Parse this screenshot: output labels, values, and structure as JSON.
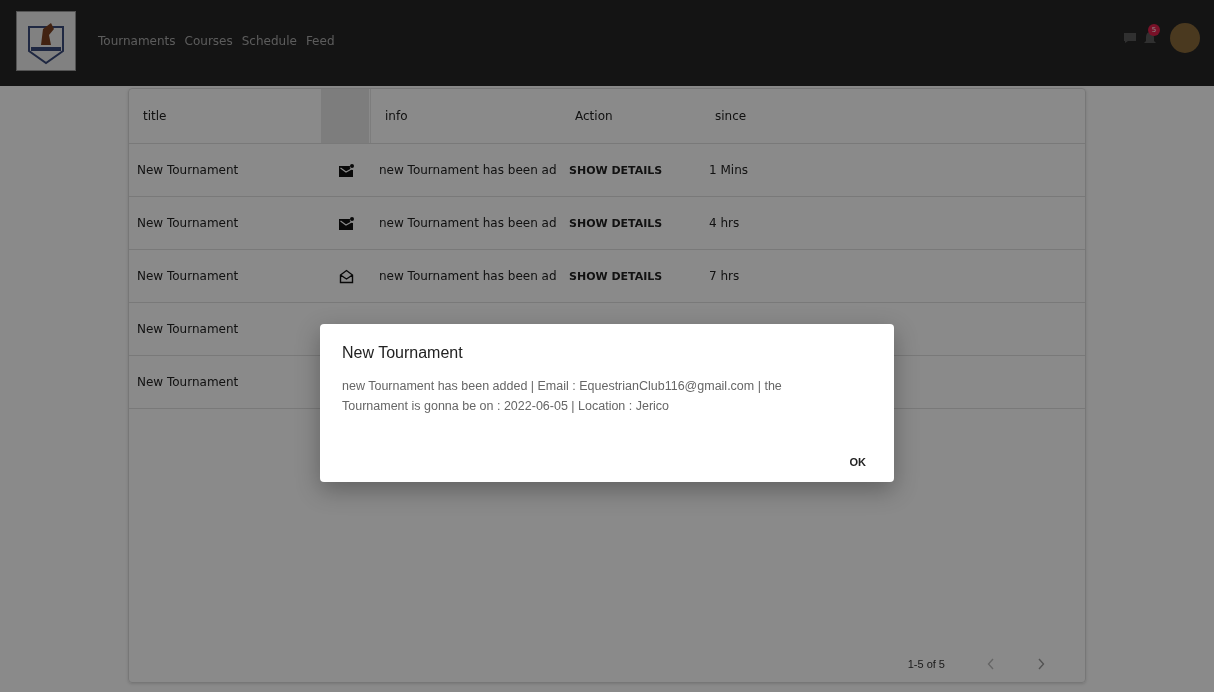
{
  "nav": {
    "links": [
      "Tournaments",
      "Courses",
      "Schedule",
      "Feed"
    ],
    "notification_count": "5"
  },
  "table": {
    "columns": [
      "title",
      "info",
      "Action",
      "since"
    ],
    "rows": [
      {
        "title": "New Tournament",
        "read": false,
        "info": "new Tournament has been ad",
        "action": "SHOW DETAILS",
        "since": "1 Mins"
      },
      {
        "title": "New Tournament",
        "read": false,
        "info": "new Tournament has been ad",
        "action": "SHOW DETAILS",
        "since": "4 hrs"
      },
      {
        "title": "New Tournament",
        "read": true,
        "info": "new Tournament has been ad",
        "action": "SHOW DETAILS",
        "since": "7 hrs"
      },
      {
        "title": "New Tournament"
      },
      {
        "title": "New Tournament"
      }
    ],
    "pagination": "1-5 of 5"
  },
  "dialog": {
    "title": "New Tournament",
    "message": "new Tournament has been added | Email : EquestrianClub116@gmail.com | the Tournament is gonna be on : 2022-06-05 | Location : Jerico",
    "button": "OK"
  }
}
